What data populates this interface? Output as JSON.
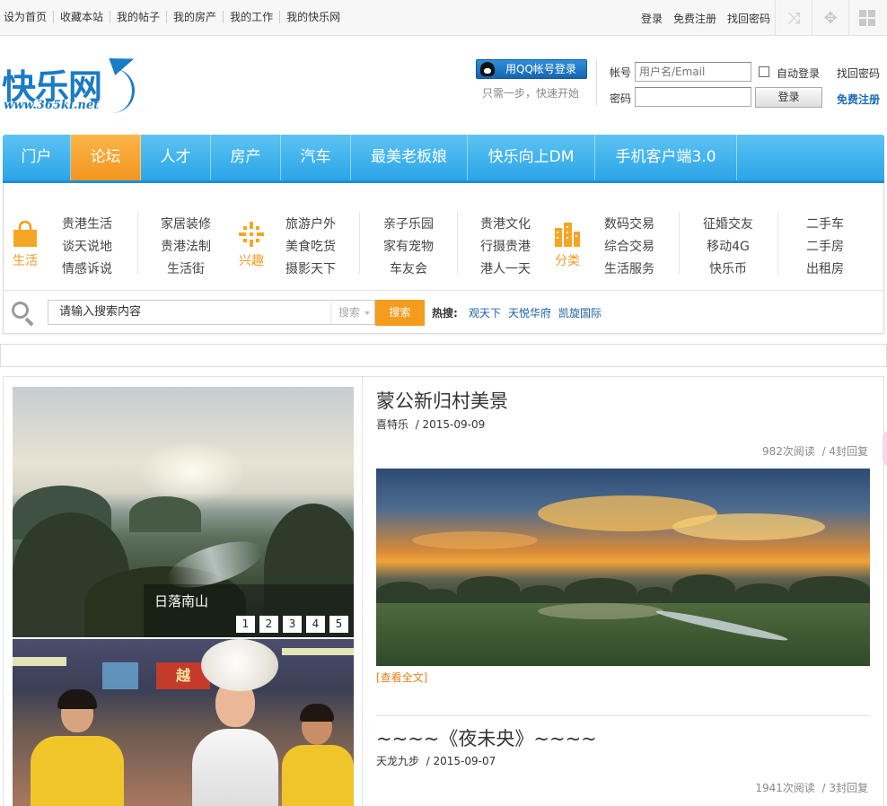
{
  "topbar": {
    "left_links": [
      "设为首页",
      "收藏本站",
      "我的帖子",
      "我的房产",
      "我的工作",
      "我的快乐网"
    ],
    "right_links": [
      "登录",
      "免费注册",
      "找回密码"
    ],
    "icons": [
      "shuffle-icon",
      "move-arrows-icon",
      "grid-icon"
    ]
  },
  "header": {
    "logo_text": "快乐网",
    "logo_url": "www.365kl.net",
    "qq_login_label": "用QQ帐号登录",
    "qq_hint": "只需一步，快速开始",
    "account_label": "帐号",
    "account_placeholder": "用户名/Email",
    "password_label": "密码",
    "auto_login_label": "自动登录",
    "find_password": "找回密码",
    "login_button": "登录",
    "register_link": "免费注册"
  },
  "nav": {
    "items": [
      "门户",
      "论坛",
      "人才",
      "房产",
      "汽车",
      "最美老板娘",
      "快乐向上DM",
      "手机客户端3.0"
    ],
    "active_index": 1,
    "active_color": "#f5a02a",
    "bar_color": "#35aceb"
  },
  "subnav": {
    "categories": [
      {
        "label": "生活",
        "icon": "shopping-bag-icon"
      },
      {
        "label": "兴趣",
        "icon": "crosshair-icon"
      },
      {
        "label": "分类",
        "icon": "buildings-icon"
      }
    ],
    "columns": [
      [
        "贵港生活",
        "谈天说地",
        "情感诉说"
      ],
      [
        "家居装修",
        "贵港法制",
        "生活街"
      ],
      [
        "旅游户外",
        "美食吃货",
        "摄影天下"
      ],
      [
        "亲子乐园",
        "家有宠物",
        "车友会"
      ],
      [
        "贵港文化",
        "行摄贵港",
        "港人一天"
      ],
      [
        "数码交易",
        "综合交易",
        "生活服务"
      ],
      [
        "征婚交友",
        "移动4G",
        "快乐币"
      ],
      [
        "二手车",
        "二手房",
        "出租房"
      ]
    ]
  },
  "search": {
    "value": "请输入搜索内容",
    "type_label": "搜索",
    "button": "搜索",
    "hot_label": "热搜:",
    "hot_links": [
      "观天下",
      "天悦华府",
      "凯旋国际"
    ]
  },
  "slider": {
    "caption": "日落南山",
    "pages": [
      "1",
      "2",
      "3",
      "4",
      "5"
    ]
  },
  "photo2": {
    "sign_text": "越"
  },
  "posts": [
    {
      "title": "蒙公新归村美景",
      "author": "喜特乐",
      "date": "2015-09-09",
      "reads": "982次阅读",
      "replies": "4封回复",
      "read_more": "[查看全文]"
    },
    {
      "title": "~~~~《夜未央》~~~~",
      "author": "天龙九步",
      "date": "2015-09-07",
      "reads": "1941次阅读",
      "replies": "3封回复"
    }
  ]
}
